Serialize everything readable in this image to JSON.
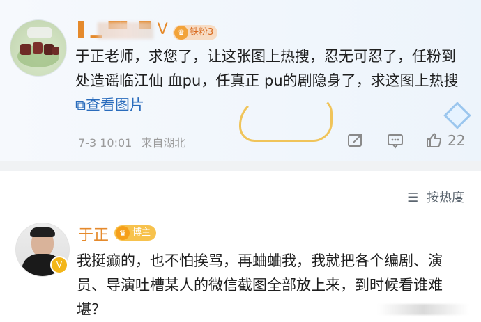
{
  "post": {
    "username": "▌▁ ▀▘ ▀ V",
    "fan_badge": "铁粉3",
    "text_main": "于正老师，求您了，让这张图上热搜，忍无可忍了，任粉到处造谣临江仙 血pu，任真正 pu的剧隐身了，求这图上热搜 ",
    "image_link": "查看图片",
    "time": "7-3 10:01",
    "location": "来自湖北",
    "like_count": "22"
  },
  "sort_label": "按热度",
  "reply": {
    "username": "于正",
    "badge": "博主",
    "text": "我挺癫的，也不怕挨骂，再蛐蛐我，我就把各个编剧、演员、导演吐槽某人的微信截图全部放上来，到时候看谁难堪？"
  },
  "icons": {
    "share": "share-icon",
    "comment": "comment-icon",
    "like": "thumb-up-icon",
    "image": "image-icon",
    "sort": "sort-icon",
    "diamond": "diamond-icon"
  },
  "colors": {
    "username": "#e58a2c",
    "link": "#2a6cbc",
    "badge_fan": "#f7dcc4",
    "badge_blogger": "#f7c24d",
    "separator": "#f0f2f4"
  }
}
